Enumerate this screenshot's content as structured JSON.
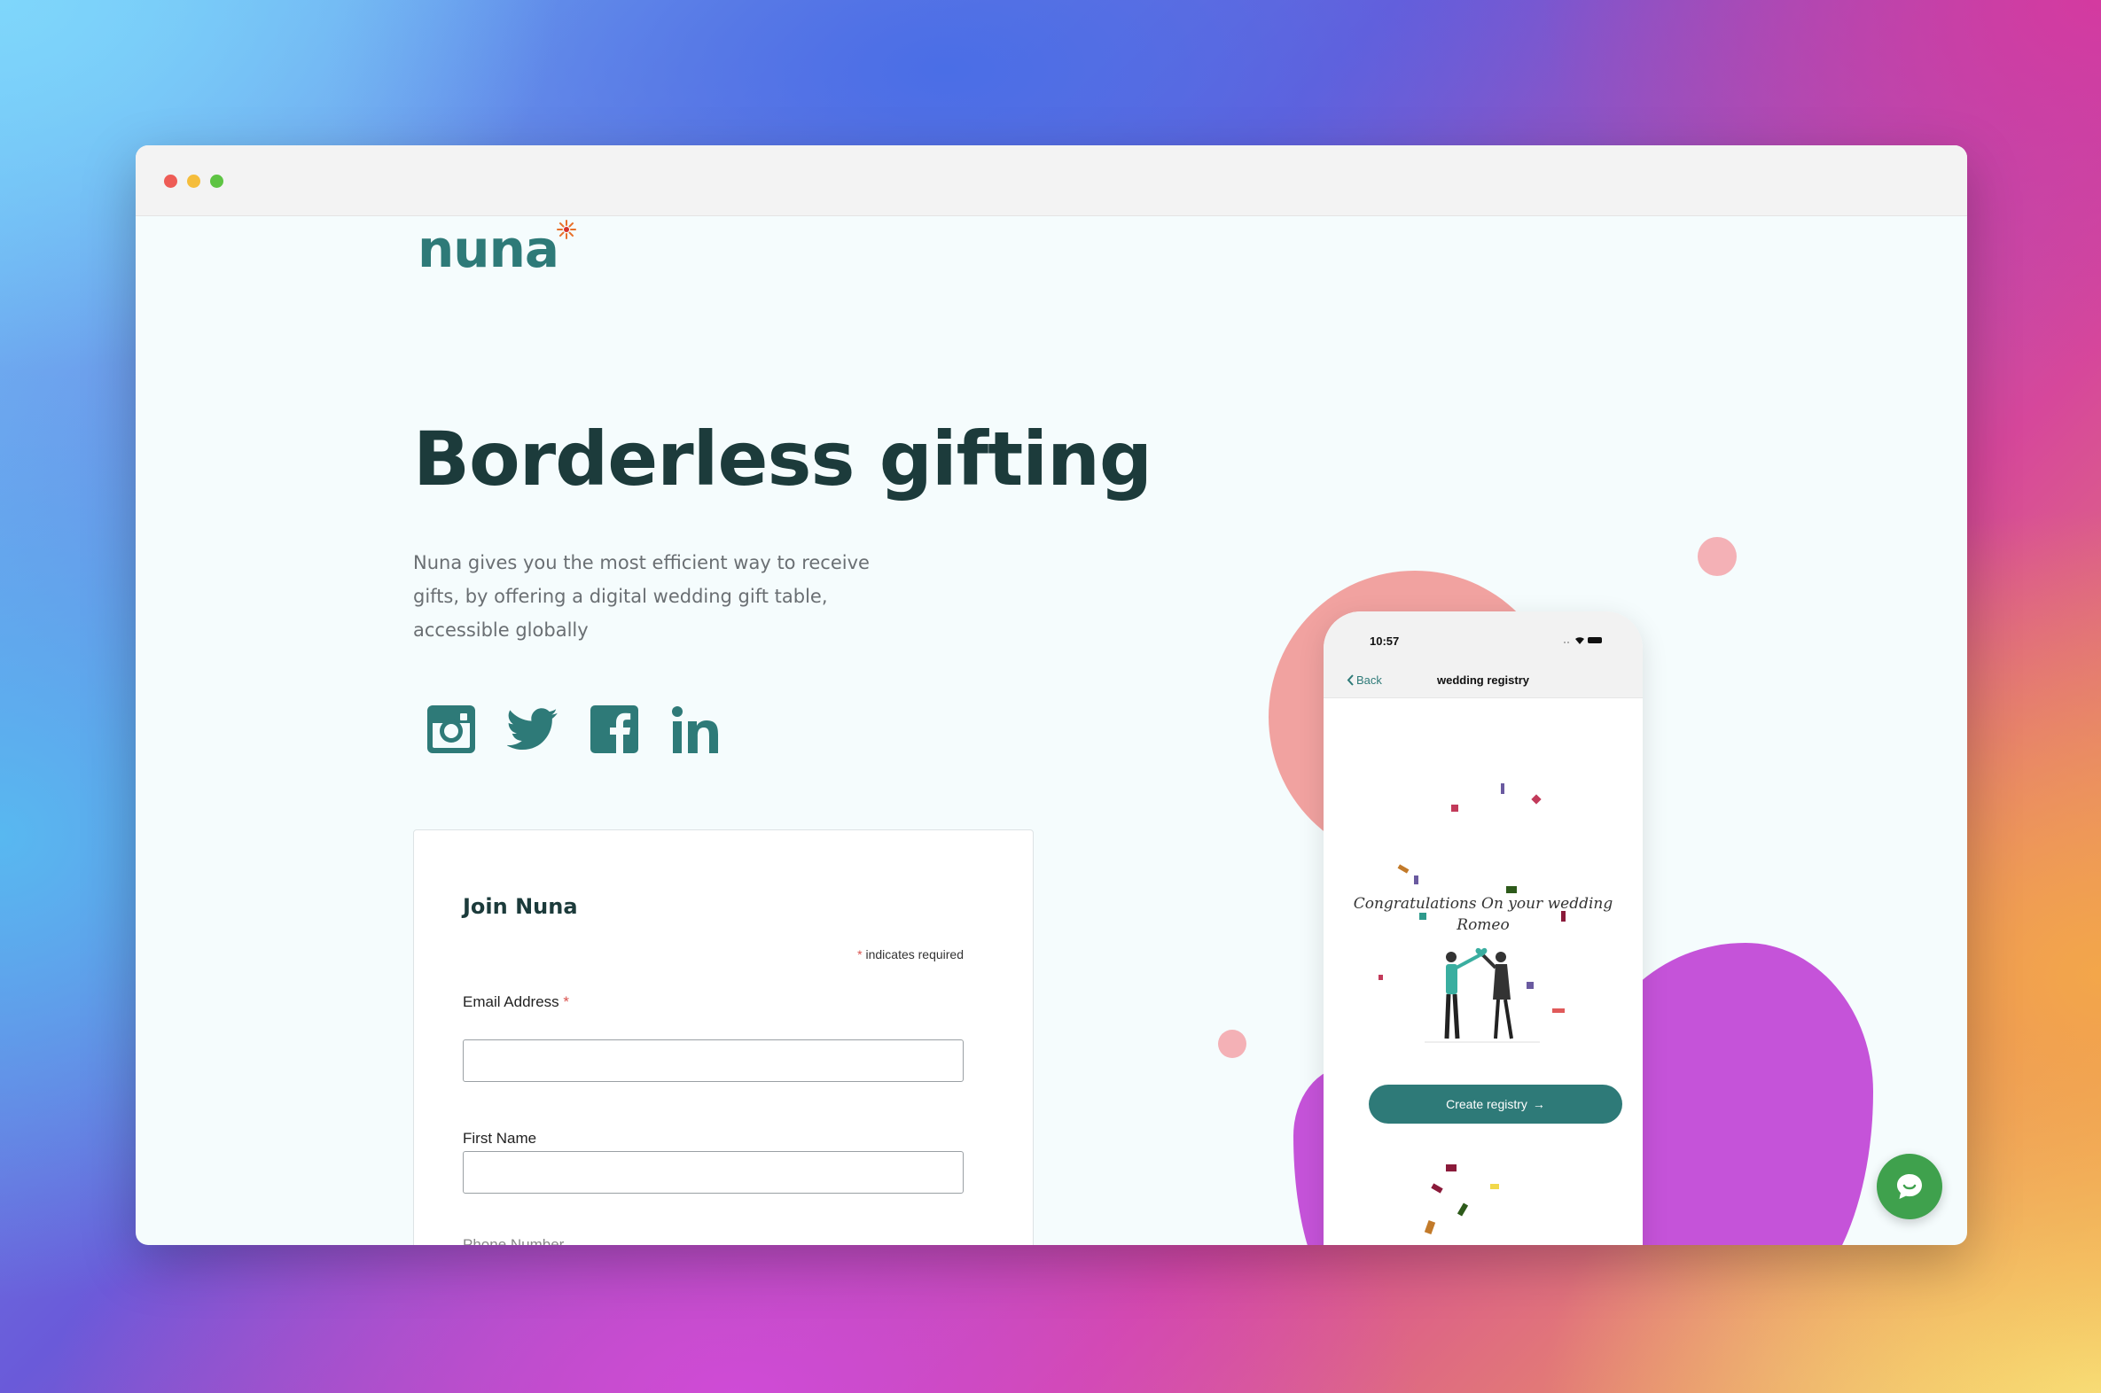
{
  "brand": {
    "logo_text": "nuna",
    "primary_color": "#2e7a78",
    "heading_color": "#1c3b3b"
  },
  "hero": {
    "title": "Borderless gifting",
    "subtitle": "Nuna gives you the most efficient way to receive gifts, by offering a digital wedding gift table, accessible globally"
  },
  "socials": [
    {
      "name": "instagram",
      "icon": "instagram-icon"
    },
    {
      "name": "twitter",
      "icon": "twitter-icon"
    },
    {
      "name": "facebook",
      "icon": "facebook-icon"
    },
    {
      "name": "linkedin",
      "icon": "linkedin-icon"
    }
  ],
  "form": {
    "title": "Join Nuna",
    "required_star": "*",
    "required_note": "indicates required",
    "fields": [
      {
        "label": "Email Address",
        "required": true,
        "value": ""
      },
      {
        "label": "First Name",
        "required": false,
        "value": ""
      },
      {
        "label": "Phone Number",
        "required": false,
        "value": ""
      }
    ]
  },
  "phone_mockup": {
    "time": "10:57",
    "back_label": "Back",
    "nav_title": "wedding registry",
    "congrats_line1": "Congratulations On your wedding",
    "congrats_line2": "Romeo",
    "cta_label": "Create registry",
    "cta_arrow": "→"
  },
  "chat": {
    "icon": "chat-bubble-icon",
    "color": "#3fa14d"
  }
}
